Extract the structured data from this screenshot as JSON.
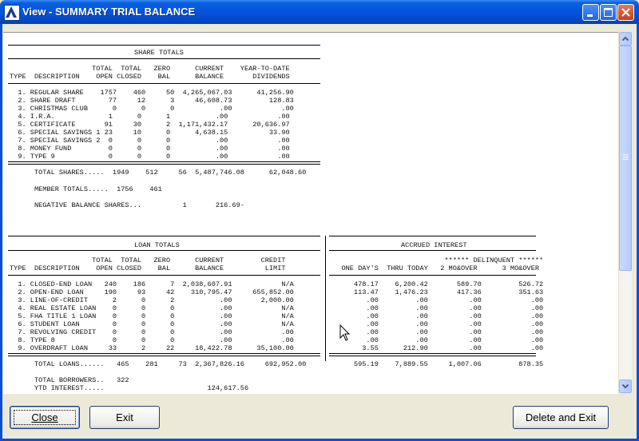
{
  "window": {
    "title": "View - SUMMARY TRIAL BALANCE"
  },
  "buttons": {
    "close": "Close",
    "exit": "Exit",
    "delete_exit": "Delete and Exit"
  },
  "share": {
    "heading": "SHARE TOTALS",
    "header1": "                    TOTAL  TOTAL   ZERO      CURRENT    YEAR-TO-DATE",
    "header2": "TYPE  DESCRIPTION    OPEN CLOSED    BAL      BALANCE       DIVIDENDS",
    "rows": [
      "  1. REGULAR SHARE    1757    460     50  4,265,067.03      41,256.90",
      "  2. SHARE DRAFT        77     12      3     46,608.73         128.83",
      "  3. CHRISTMAS CLUB      0      0      0           .00            .00",
      "  4. I.R.A.             1      0      1           .00            .00",
      "  5. CERTIFICATE       91     30      2  1,171,432.17      20,636.97",
      "  6. SPECIAL SAVINGS 1 23     10      0      4,638.15          33.90",
      "  7. SPECIAL SAVINGS 2  0      0      0           .00            .00",
      "  8. MONEY FUND         0      0      0           .00            .00",
      "  9. TYPE 9             0      0      0           .00            .00"
    ],
    "total": "      TOTAL SHARES.....  1949    512     56  5,487,746.08      62,048.60",
    "members": "      MEMBER TOTALS.....  1756    461",
    "negative": "      NEGATIVE BALANCE SHARES...          1       216.69-"
  },
  "loan": {
    "heading": "LOAN TOTALS",
    "header1": "                    TOTAL  TOTAL   ZERO      CURRENT         CREDIT",
    "header2": "TYPE  DESCRIPTION    OPEN CLOSED    BAL      BALANCE          LIMIT",
    "rows": [
      "  1. CLOSED-END LOAN   240    186      7  2,038,607.91            N/A",
      "  2. OPEN-END LOAN     190     93     42    310,795.47     655,852.00",
      "  3. LINE-OF-CREDIT      2      0      2           .00       2,000.00",
      "  4. REAL ESTATE LOAN    0      0      0           .00            N/A",
      "  5. FHA TITLE 1 LOAN    0      0      0           .00            N/A",
      "  6. STUDENT LOAN        0      0      0           .00            N/A",
      "  7. REVOLVING CREDIT    0      0      0           .00            .00",
      "  8. TYPE 8              0      0      0           .00            .00",
      "  9. OVERDRAFT LOAN     33      2     22     18,422.78      35,100.00"
    ],
    "total": "      TOTAL LOANS......   465    281     73  2,367,826.16     692,952.00",
    "borrowers": "      TOTAL BORROWERS..   322",
    "ytd": "      YTD INTEREST.....                         124,617.56"
  },
  "accrued": {
    "heading": "ACCRUED INTEREST",
    "header1": "                            ****** DELINQUENT ******",
    "header2": "   ONE DAY'S  THRU TODAY   2 MO&OVER      3 MO&OVER",
    "rows": [
      "      478.17    6,200.42       589.70         526.72",
      "      113.47    1,476.23       417.36         351.63",
      "         .00         .00          .00            .00",
      "         .00         .00          .00            .00",
      "         .00         .00          .00            .00",
      "         .00         .00          .00            .00",
      "         .00         .00          .00            .00",
      "         .00         .00          .00            .00",
      "        3.55      212.90          .00            .00"
    ],
    "total": "      595.19    7,889.55     1,007.06         878.35"
  }
}
